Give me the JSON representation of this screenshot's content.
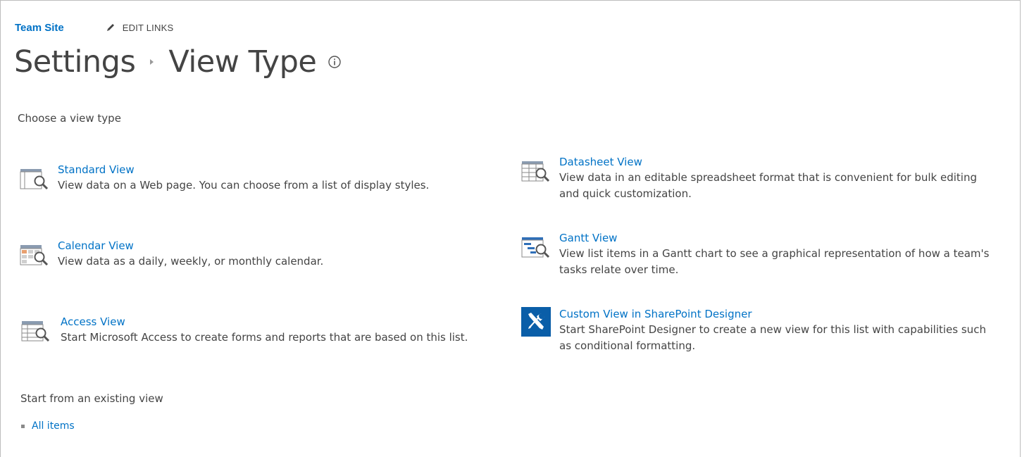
{
  "top_nav": {
    "site_title": "Team Site",
    "edit_links_label": "EDIT LINKS"
  },
  "page_title": {
    "parent": "Settings",
    "current": "View Type"
  },
  "choose_section": {
    "label": "Choose a view type"
  },
  "view_types": [
    {
      "title": "Standard View",
      "description": "View data on a Web page. You can choose from a list of display styles.",
      "icon": "standard-view-icon"
    },
    {
      "title": "Calendar View",
      "description": "View data as a daily, weekly, or monthly calendar.",
      "icon": "calendar-view-icon"
    },
    {
      "title": "Access View",
      "description": "Start Microsoft Access to create forms and reports that are based on this list.",
      "icon": "access-view-icon"
    },
    {
      "title": "Datasheet View",
      "description_line1": "View data in an editable spreadsheet format that is convenient for bulk editing",
      "description_line2": "and quick customization.",
      "icon": "datasheet-view-icon"
    },
    {
      "title": "Gantt View",
      "description_line1": "View list items in a Gantt chart to see a graphical representation of how a team's",
      "description_line2": "tasks relate over time.",
      "icon": "gantt-view-icon"
    },
    {
      "title": "Custom View in SharePoint Designer",
      "description_line1": "Start SharePoint Designer to create a new view for this list with capabilities such",
      "description_line2": "as conditional formatting.",
      "icon": "sharepoint-designer-icon"
    }
  ],
  "existing_section": {
    "label": "Start from an existing view",
    "items": [
      "All items"
    ]
  },
  "colors": {
    "link": "#0072c6",
    "text": "#444444",
    "designer_tile": "#0a5ea8"
  }
}
